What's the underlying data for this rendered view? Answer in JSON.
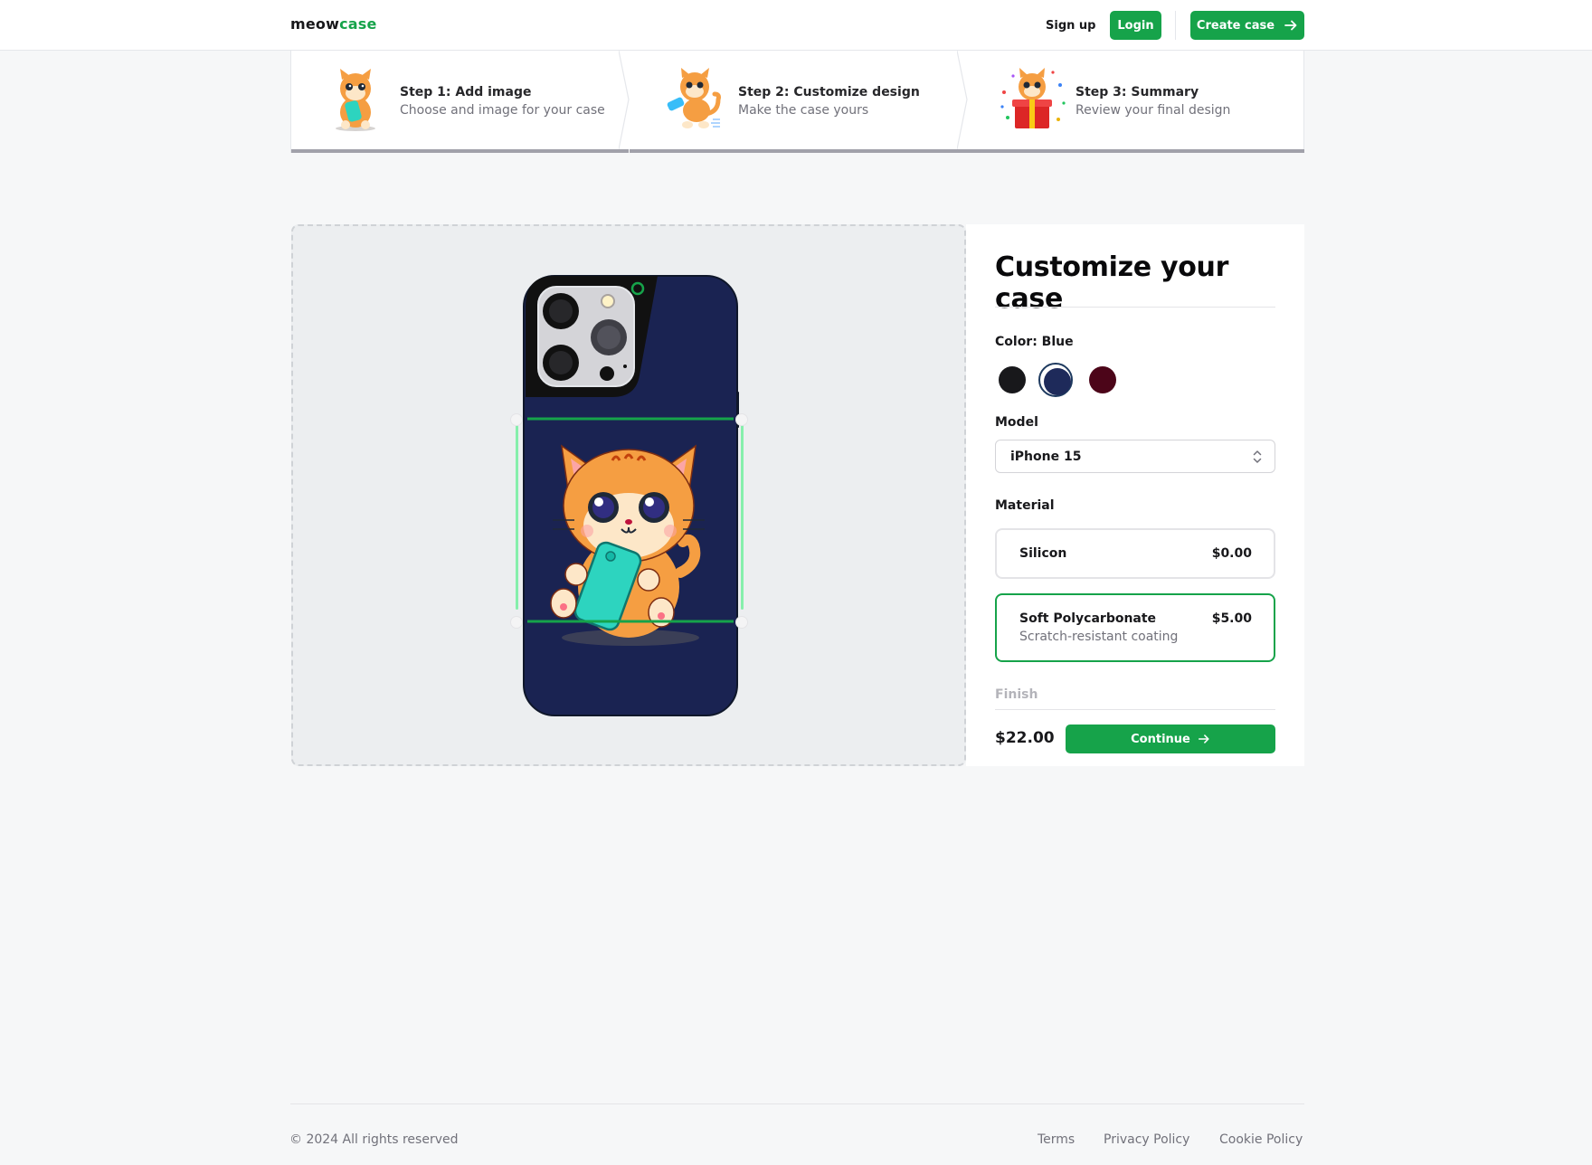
{
  "nav": {
    "logo_part1": "meow",
    "logo_part2": "case",
    "sign_up": "Sign up",
    "login": "Login",
    "create_case": "Create case"
  },
  "steps": [
    {
      "title": "Step 1: Add image",
      "subtitle": "Choose and image for your case",
      "icon": "cat-holding-phone-icon"
    },
    {
      "title": "Step 2: Customize design",
      "subtitle": "Make the case yours",
      "icon": "cat-running-with-phone-icon"
    },
    {
      "title": "Step 3: Summary",
      "subtitle": "Review your final design",
      "icon": "cat-gift-box-icon"
    }
  ],
  "editor": {
    "case_color": "#1a2352",
    "design_image": "cat-with-phone-sticker"
  },
  "panel": {
    "heading": "Customize your case",
    "color_label": "Color: Blue",
    "colors": [
      {
        "name": "Black",
        "hex": "#18181b",
        "selected": false
      },
      {
        "name": "Blue",
        "hex": "#1e2a5a",
        "selected": true
      },
      {
        "name": "Rose",
        "hex": "#4c0519",
        "selected": false
      }
    ],
    "model_label": "Model",
    "model_value": "iPhone 15",
    "material_label": "Material",
    "materials": [
      {
        "name": "Silicon",
        "price": "$0.00",
        "description": "",
        "selected": false
      },
      {
        "name": "Soft Polycarbonate",
        "price": "$5.00",
        "description": "Scratch-resistant coating",
        "selected": true
      }
    ],
    "finish_label": "Finish",
    "total": "$22.00",
    "continue": "Continue"
  },
  "footer": {
    "copyright": "© 2024 All rights reserved",
    "links": [
      "Terms",
      "Privacy Policy",
      "Cookie Policy"
    ]
  },
  "colors": {
    "accent": "#16a34a",
    "step_bar": "#a1a1aa"
  }
}
